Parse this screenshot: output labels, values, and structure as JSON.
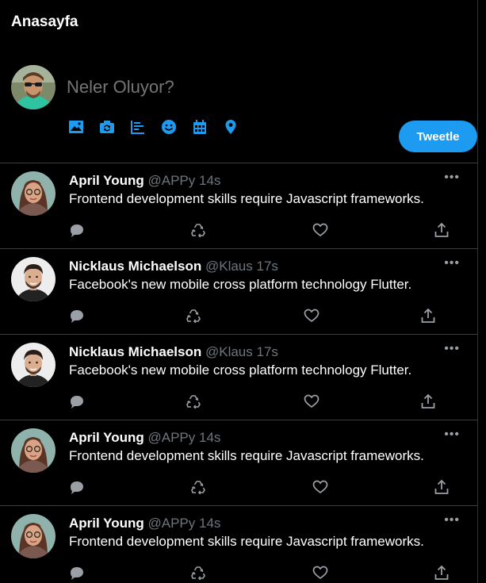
{
  "header": {
    "title": "Anasayfa"
  },
  "composer": {
    "placeholder": "Neler Oluyor?",
    "tweet_button": "Tweetle",
    "tools": [
      "image-icon",
      "gif-icon",
      "poll-icon",
      "emoji-icon",
      "schedule-icon",
      "location-icon"
    ]
  },
  "colors": {
    "accent": "#1d9bf0",
    "muted": "#6e767d",
    "background": "#000000"
  },
  "tweets": [
    {
      "name": "April Young",
      "handle": "@APPy",
      "time": "14s",
      "text": "Frontend development skills require Javascript frameworks.",
      "avatar": "april"
    },
    {
      "name": "Nicklaus Michaelson",
      "handle": "@Klaus",
      "time": "17s",
      "text": "Facebook's new mobile cross platform technology Flutter.",
      "avatar": "nicklaus"
    },
    {
      "name": "Nicklaus Michaelson",
      "handle": "@Klaus",
      "time": "17s",
      "text": "Facebook's new mobile cross platform technology Flutter.",
      "avatar": "nicklaus"
    },
    {
      "name": "April Young",
      "handle": "@APPy",
      "time": "14s",
      "text": "Frontend development skills require Javascript frameworks.",
      "avatar": "april"
    },
    {
      "name": "April Young",
      "handle": "@APPy",
      "time": "14s",
      "text": "Frontend development skills require Javascript frameworks.",
      "avatar": "april"
    }
  ]
}
